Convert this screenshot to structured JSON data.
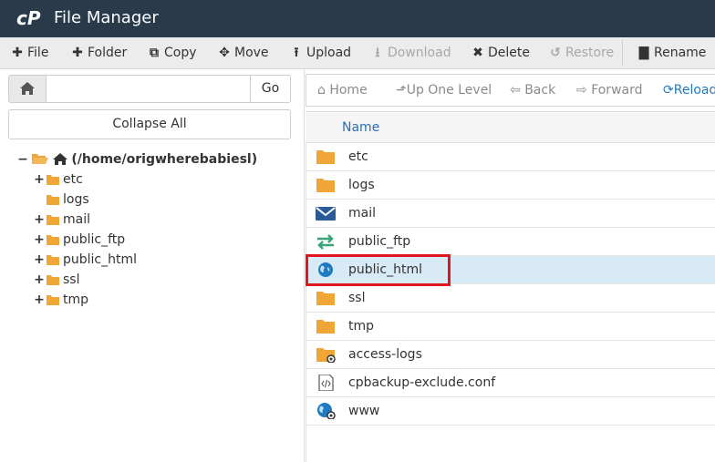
{
  "app": {
    "title": "File Manager",
    "logo_icon": "cpanel-logo-icon"
  },
  "toolbar": [
    {
      "label": "File",
      "icon": "plus-icon",
      "disabled": false
    },
    {
      "label": "Folder",
      "icon": "plus-icon",
      "disabled": false
    },
    {
      "label": "Copy",
      "icon": "copy-icon",
      "disabled": false
    },
    {
      "label": "Move",
      "icon": "move-arrows-icon",
      "disabled": false
    },
    {
      "label": "Upload",
      "icon": "upload-icon",
      "disabled": false
    },
    {
      "label": "Download",
      "icon": "download-icon",
      "disabled": true
    },
    {
      "label": "Delete",
      "icon": "close-icon",
      "disabled": false
    },
    {
      "label": "Restore",
      "icon": "undo-icon",
      "disabled": true
    },
    {
      "label": "Rename",
      "icon": "file-icon",
      "disabled": false
    }
  ],
  "left": {
    "path_value": "",
    "go_label": "Go",
    "collapse_label": "Collapse All",
    "tree_root": "(/home/origwherebabiesl)",
    "tree": [
      {
        "label": "etc",
        "expandable": true
      },
      {
        "label": "logs",
        "expandable": false
      },
      {
        "label": "mail",
        "expandable": true
      },
      {
        "label": "public_ftp",
        "expandable": true
      },
      {
        "label": "public_html",
        "expandable": true
      },
      {
        "label": "ssl",
        "expandable": true
      },
      {
        "label": "tmp",
        "expandable": true
      }
    ]
  },
  "nav": {
    "home": "Home",
    "up": "Up One Level",
    "back": "Back",
    "forward": "Forward",
    "reload": "Reload"
  },
  "table": {
    "name_header": "Name",
    "rows": [
      {
        "name": "etc",
        "icon": "folder-icon",
        "selected": false
      },
      {
        "name": "logs",
        "icon": "folder-icon",
        "selected": false
      },
      {
        "name": "mail",
        "icon": "mail-icon",
        "selected": false
      },
      {
        "name": "public_ftp",
        "icon": "transfer-arrows-icon",
        "selected": false
      },
      {
        "name": "public_html",
        "icon": "globe-icon",
        "selected": true
      },
      {
        "name": "ssl",
        "icon": "folder-icon",
        "selected": false
      },
      {
        "name": "tmp",
        "icon": "folder-icon",
        "selected": false
      },
      {
        "name": "access-logs",
        "icon": "folder-link-icon",
        "selected": false
      },
      {
        "name": "cpbackup-exclude.conf",
        "icon": "code-file-icon",
        "selected": false
      },
      {
        "name": "www",
        "icon": "globe-link-icon",
        "selected": false
      }
    ]
  },
  "colors": {
    "header_bg": "#293a4a",
    "folder": "#f0a537",
    "accent": "#1f7bc1",
    "selection": "#d9eaf7",
    "highlight": "#e0151e"
  }
}
